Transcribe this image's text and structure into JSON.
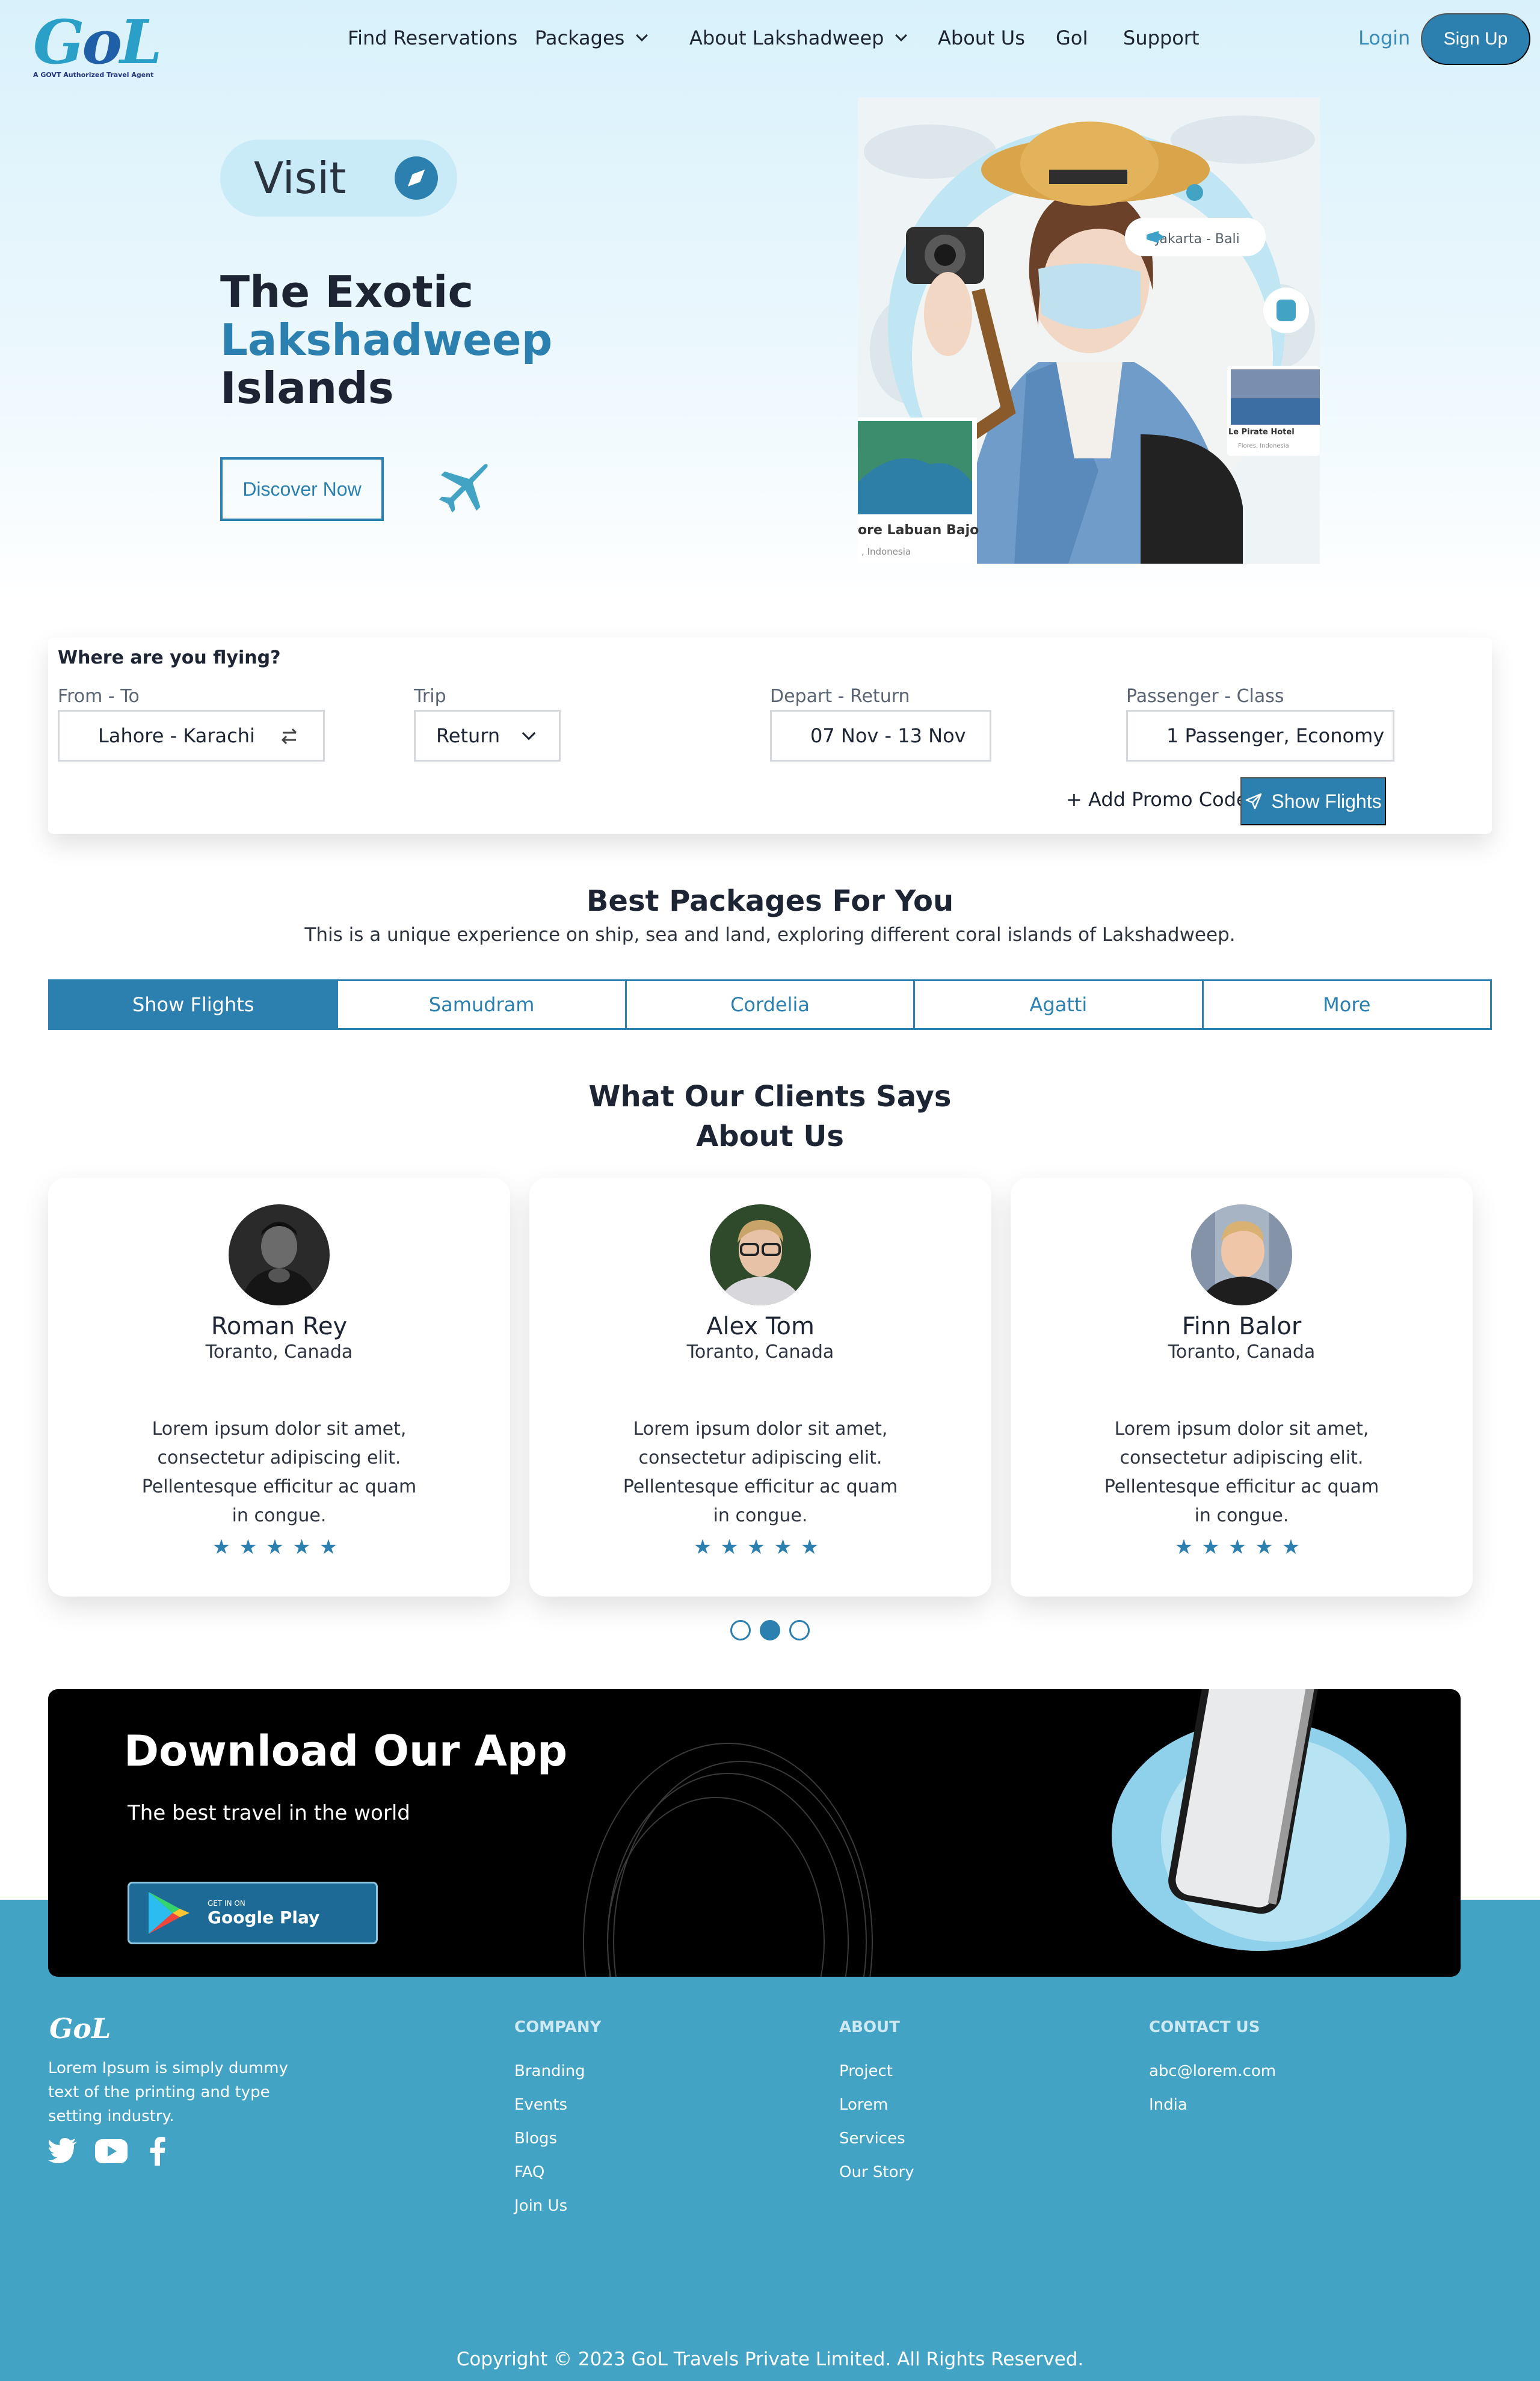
{
  "brand": {
    "logo_text": "GoL",
    "tagline": "A GOVT Authorized Travel Agent"
  },
  "nav": {
    "items": [
      "Find Reservations",
      "Packages",
      "About Lakshadweep",
      "About Us",
      "GoI",
      "Support"
    ],
    "login": "Login",
    "signup": "Sign Up"
  },
  "hero": {
    "visit": "Visit",
    "title_1": "The Exotic",
    "title_2": "Lakshadweep",
    "title_3": "Islands",
    "cta": "Discover Now",
    "image_card_route": "Jakarta - Bali",
    "image_card_hotel": "Le Pirate Hotel",
    "image_card_hotel_loc": "Flores, Indonesia",
    "image_card_place": "ore Labuan Bajo",
    "image_card_place_loc": ", Indonesia"
  },
  "search": {
    "question": "Where are you flying?",
    "from_label": "From - To",
    "from_value": "Lahore - Karachi",
    "trip_label": "Trip",
    "trip_value": "Return",
    "date_label": "Depart - Return",
    "date_value": "07 Nov - 13 Nov",
    "pass_label": "Passenger - Class",
    "pass_value": "1 Passenger, Economy",
    "promo": "+ Add Promo Code",
    "submit": "Show Flights"
  },
  "packages": {
    "title": "Best Packages For You",
    "subtitle": "This is a unique experience on ship, sea and land, exploring different coral islands of Lakshadweep.",
    "tabs": [
      "Show Flights",
      "Samudram",
      "Cordelia",
      "Agatti",
      "More"
    ],
    "active_tab": 0
  },
  "testimonials": {
    "title_1": "What Our Clients Says",
    "title_2": "About Us",
    "cards": [
      {
        "name": "Roman Rey",
        "location": "Toranto, Canada",
        "text": "Lorem ipsum dolor sit amet, consectetur adipiscing elit. Pellentesque efficitur ac quam in congue.",
        "rating": 5
      },
      {
        "name": "Alex Tom",
        "location": "Toranto, Canada",
        "text": "Lorem ipsum dolor sit amet, consectetur adipiscing elit. Pellentesque efficitur ac quam in congue.",
        "rating": 5
      },
      {
        "name": "Finn Balor",
        "location": "Toranto, Canada",
        "text": "Lorem ipsum dolor sit amet, consectetur adipiscing elit. Pellentesque efficitur ac quam in congue.",
        "rating": 5
      }
    ],
    "carousel_active": 1
  },
  "app": {
    "title": "Download Our App",
    "subtitle": "The best travel in the world",
    "store_small": "GET IN ON",
    "store_big": "Google Play"
  },
  "footer": {
    "logo": "GoL",
    "description": "Lorem Ipsum is simply dummy text of the printing and type setting industry.",
    "company_title": "COMPANY",
    "company_links": [
      "Branding",
      "Events",
      "Blogs",
      "FAQ",
      "Join Us"
    ],
    "about_title": "ABOUT",
    "about_links": [
      "Project",
      "Lorem",
      "Services",
      "Our Story"
    ],
    "contact_title": "CONTACT US",
    "contact_links": [
      "abc@lorem.com",
      "India"
    ],
    "copyright": "Copyright © 2023 GoL Travels Private Limited. All Rights Reserved."
  },
  "colors": {
    "primary": "#2b80b0",
    "accent": "#42a3c4",
    "hero_bg": "#d9f1fb",
    "text": "#1d2433"
  },
  "icons": [
    "compass-icon",
    "airplane-icon",
    "swap-icon",
    "chevron-down-icon",
    "send-icon",
    "star-icon",
    "google-play-icon",
    "twitter-icon",
    "youtube-icon",
    "facebook-icon"
  ]
}
